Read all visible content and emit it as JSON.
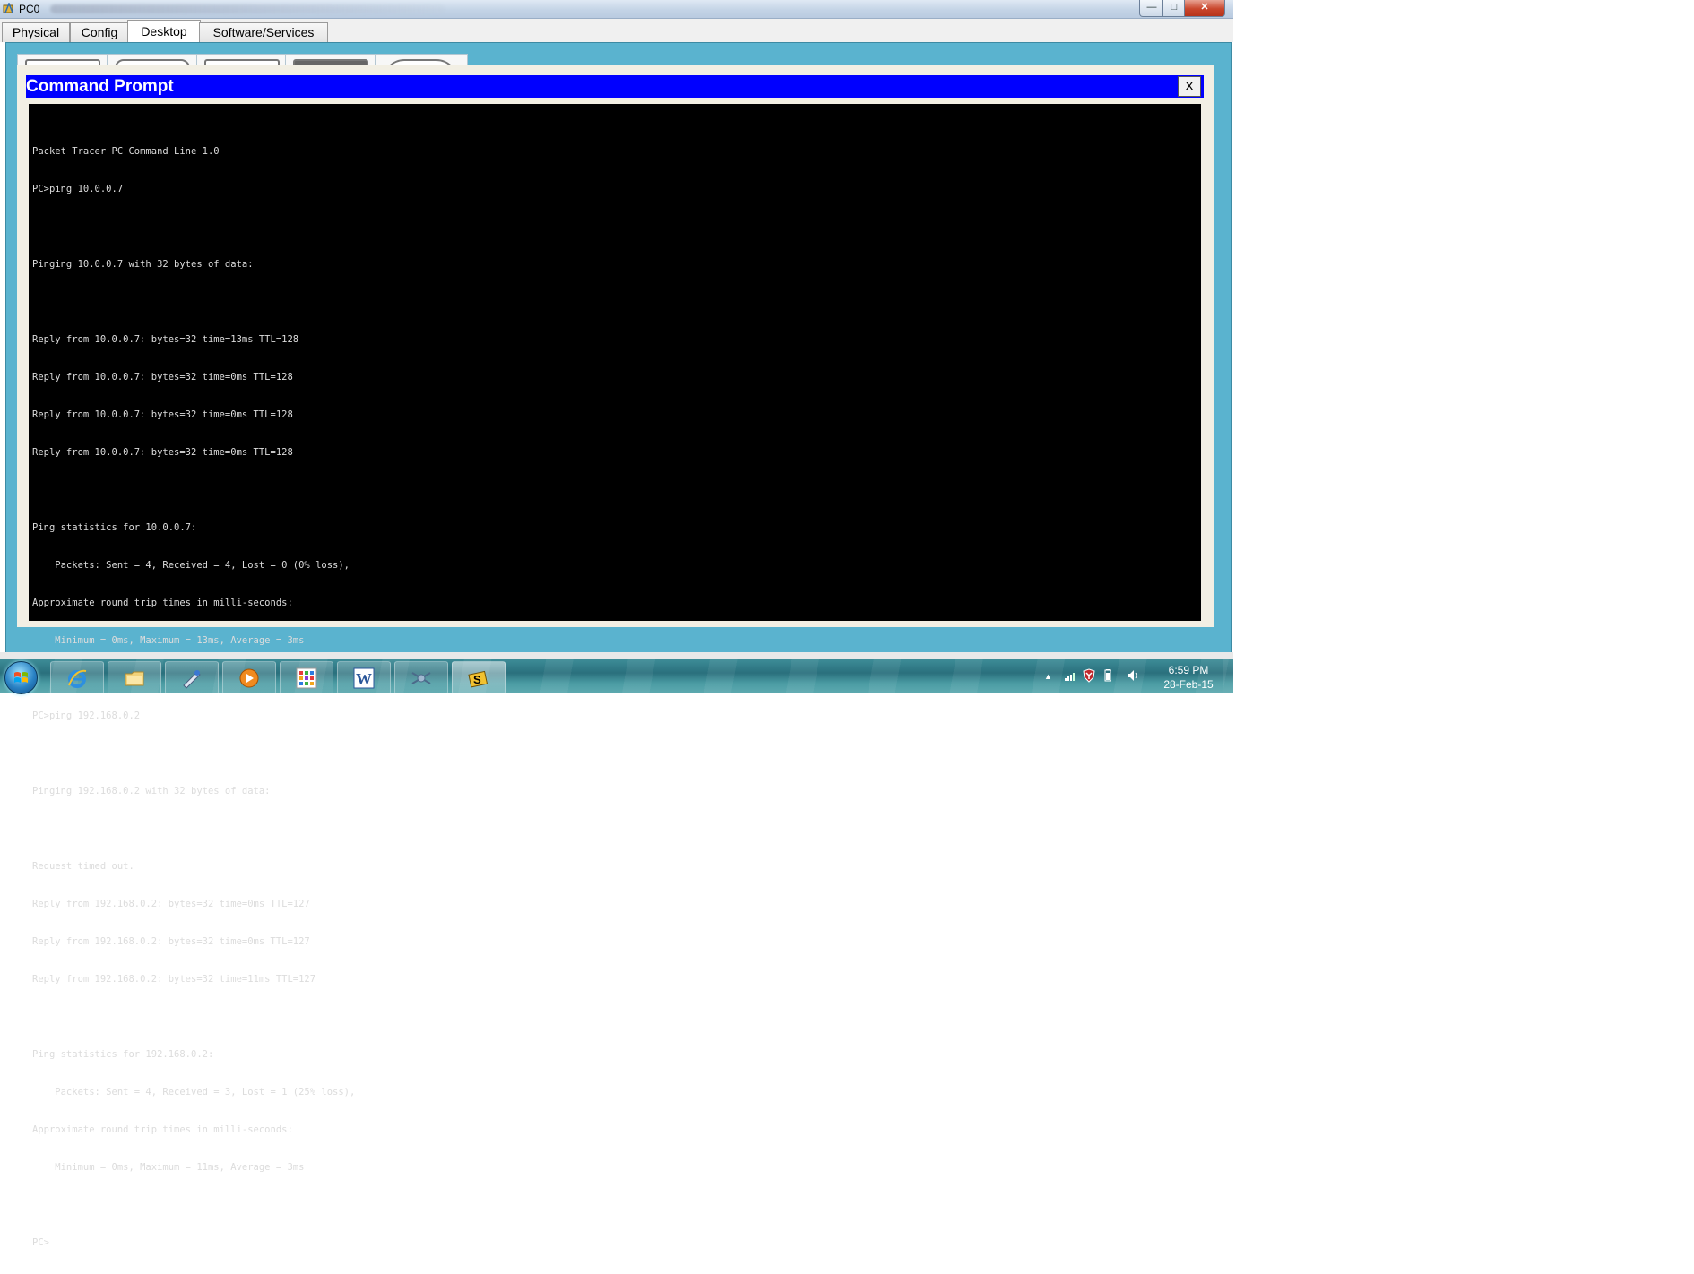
{
  "window": {
    "title": "PC0",
    "buttons": {
      "minimize": "—",
      "maximize": "□",
      "close": "✕"
    }
  },
  "tabs": [
    {
      "label": "Physical"
    },
    {
      "label": "Config"
    },
    {
      "label": "Desktop",
      "active": true
    },
    {
      "label": "Software/Services"
    }
  ],
  "command_prompt": {
    "title": "Command Prompt",
    "close_label": "X",
    "lines": [
      "Packet Tracer PC Command Line 1.0",
      "PC>ping 10.0.0.7",
      "",
      "Pinging 10.0.0.7 with 32 bytes of data:",
      "",
      "Reply from 10.0.0.7: bytes=32 time=13ms TTL=128",
      "Reply from 10.0.0.7: bytes=32 time=0ms TTL=128",
      "Reply from 10.0.0.7: bytes=32 time=0ms TTL=128",
      "Reply from 10.0.0.7: bytes=32 time=0ms TTL=128",
      "",
      "Ping statistics for 10.0.0.7:",
      "    Packets: Sent = 4, Received = 4, Lost = 0 (0% loss),",
      "Approximate round trip times in milli-seconds:",
      "    Minimum = 0ms, Maximum = 13ms, Average = 3ms",
      "",
      "PC>ping 192.168.0.2",
      "",
      "Pinging 192.168.0.2 with 32 bytes of data:",
      "",
      "Request timed out.",
      "Reply from 192.168.0.2: bytes=32 time=0ms TTL=127",
      "Reply from 192.168.0.2: bytes=32 time=0ms TTL=127",
      "Reply from 192.168.0.2: bytes=32 time=11ms TTL=127",
      "",
      "Ping statistics for 192.168.0.2:",
      "    Packets: Sent = 4, Received = 3, Lost = 1 (25% loss),",
      "Approximate round trip times in milli-seconds:",
      "    Minimum = 0ms, Maximum = 11ms, Average = 3ms",
      "",
      "PC>"
    ]
  },
  "taskbar": {
    "items": [
      {
        "icon": "internet-explorer-icon"
      },
      {
        "icon": "folder-icon"
      },
      {
        "icon": "paint-icon"
      },
      {
        "icon": "media-player-icon"
      },
      {
        "icon": "apps-grid-icon"
      },
      {
        "icon": "word-icon"
      },
      {
        "icon": "network-tool-icon"
      },
      {
        "icon": "packet-tracer-icon",
        "active": true
      }
    ],
    "tray": {
      "icons": [
        "signal-icon",
        "shield-icon",
        "battery-icon",
        "speaker-icon"
      ],
      "time": "6:59 PM",
      "date": "28-Feb-15"
    }
  },
  "colors": {
    "desktop_bg": "#5ab3cf",
    "cmd_title_bg": "#0000ff",
    "terminal_bg": "#000000",
    "terminal_fg": "#dcdcdc"
  }
}
